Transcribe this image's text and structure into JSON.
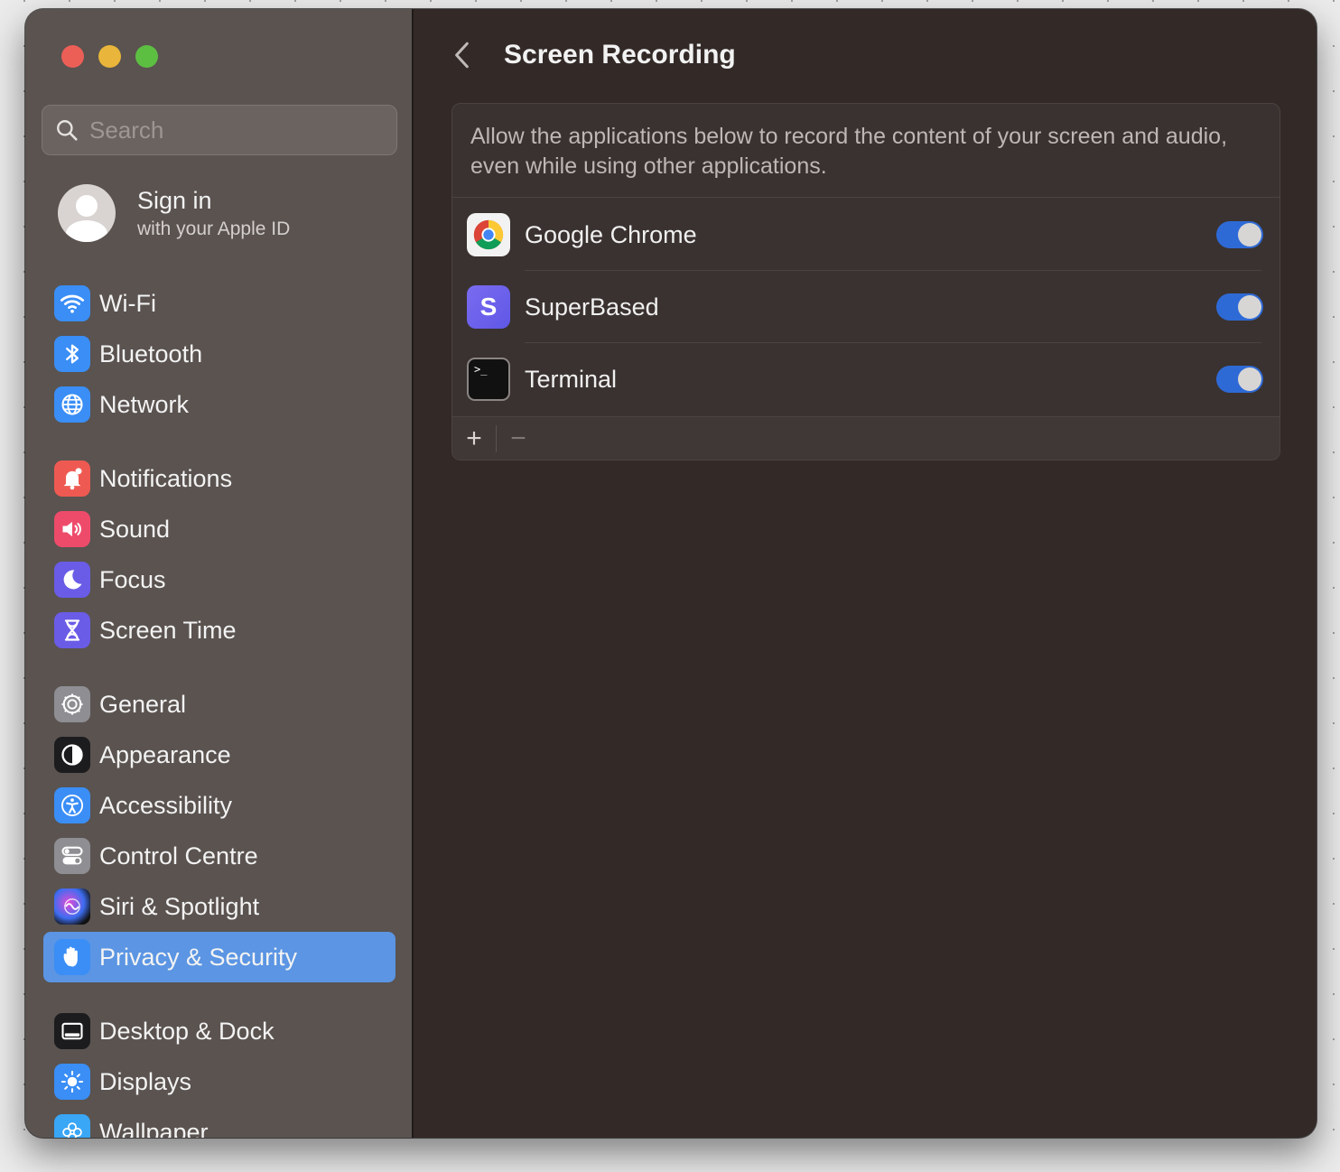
{
  "sidebar": {
    "search_placeholder": "Search",
    "signin": {
      "title": "Sign in",
      "subtitle": "with your Apple ID"
    },
    "items": [
      {
        "label": "Wi-Fi",
        "icon": "wifi-icon",
        "color": "#3a8ef6"
      },
      {
        "label": "Bluetooth",
        "icon": "bluetooth-icon",
        "color": "#3a8ef6"
      },
      {
        "label": "Network",
        "icon": "globe-icon",
        "color": "#3a8ef6"
      },
      {
        "label": "Notifications",
        "icon": "bell-icon",
        "color": "#ee5a52"
      },
      {
        "label": "Sound",
        "icon": "speaker-icon",
        "color": "#ee4b6a"
      },
      {
        "label": "Focus",
        "icon": "moon-icon",
        "color": "#6a5ce6"
      },
      {
        "label": "Screen Time",
        "icon": "hourglass-icon",
        "color": "#6a5ce6"
      },
      {
        "label": "General",
        "icon": "gear-icon",
        "color": "#8e8e93"
      },
      {
        "label": "Appearance",
        "icon": "appearance-icon",
        "color": "#1c1c1e"
      },
      {
        "label": "Accessibility",
        "icon": "accessibility-icon",
        "color": "#3a8ef6"
      },
      {
        "label": "Control Centre",
        "icon": "switches-icon",
        "color": "#8e8e93"
      },
      {
        "label": "Siri & Spotlight",
        "icon": "siri-icon",
        "color": "#222"
      },
      {
        "label": "Privacy & Security",
        "icon": "hand-icon",
        "color": "#3a8ef6",
        "active": true
      },
      {
        "label": "Desktop & Dock",
        "icon": "dock-icon",
        "color": "#1c1c1e"
      },
      {
        "label": "Displays",
        "icon": "sun-icon",
        "color": "#3a8ef6"
      },
      {
        "label": "Wallpaper",
        "icon": "flower-icon",
        "color": "#3aa6f6"
      }
    ]
  },
  "main": {
    "title": "Screen Recording",
    "description": "Allow the applications below to record the content of your screen and audio, even while using other applications.",
    "apps": [
      {
        "name": "Google Chrome",
        "icon": "chrome-icon",
        "enabled": true
      },
      {
        "name": "SuperBased",
        "icon": "superbased-icon",
        "icon_letter": "S",
        "enabled": true
      },
      {
        "name": "Terminal",
        "icon": "terminal-icon",
        "icon_text": ">_",
        "enabled": true
      }
    ],
    "footer": {
      "add": "+",
      "remove": "−"
    }
  },
  "colors": {
    "accent": "#2e6ad6",
    "selection": "#5b95e3"
  }
}
